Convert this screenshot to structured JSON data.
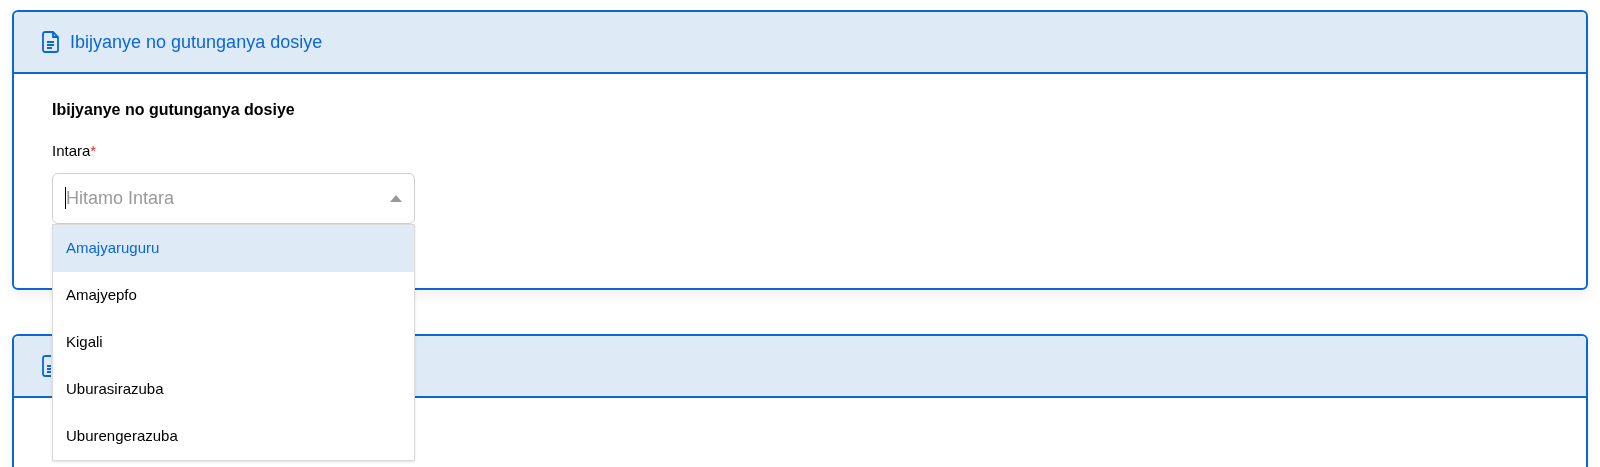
{
  "cards": [
    {
      "kind": "form",
      "header": "Ibijyanye no gutunganya dosiye",
      "section_title": "Ibijyanye no gutunganya dosiye",
      "field": {
        "label": "Intara",
        "required_mark": "*",
        "placeholder": "Hitamo Intara",
        "expanded": true,
        "options": [
          {
            "label": "Amajyaruguru",
            "selected": true
          },
          {
            "label": "Amajyepfo",
            "selected": false
          },
          {
            "label": "Kigali",
            "selected": false
          },
          {
            "label": "Uburasirazuba",
            "selected": false
          },
          {
            "label": "Uburengerazuba",
            "selected": false
          }
        ]
      }
    },
    {
      "kind": "covered"
    }
  ]
}
